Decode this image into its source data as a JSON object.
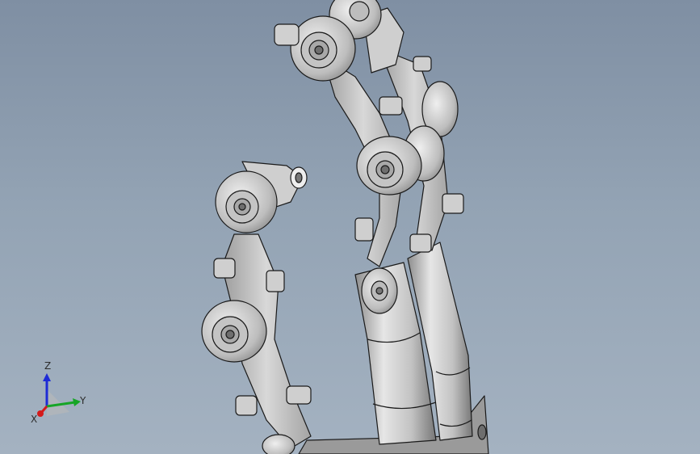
{
  "viewport": {
    "background_top": "#7f8fa3",
    "background_bottom": "#a4b2c1"
  },
  "model": {
    "shade_color": "#c9c9c9",
    "edge_color": "#1a1a1a"
  },
  "triad": {
    "z_label": "Z",
    "y_label": "Y",
    "x_label": "X",
    "z_color": "#1e2bd6",
    "y_color": "#16a526",
    "x_color": "#d41a1a"
  }
}
